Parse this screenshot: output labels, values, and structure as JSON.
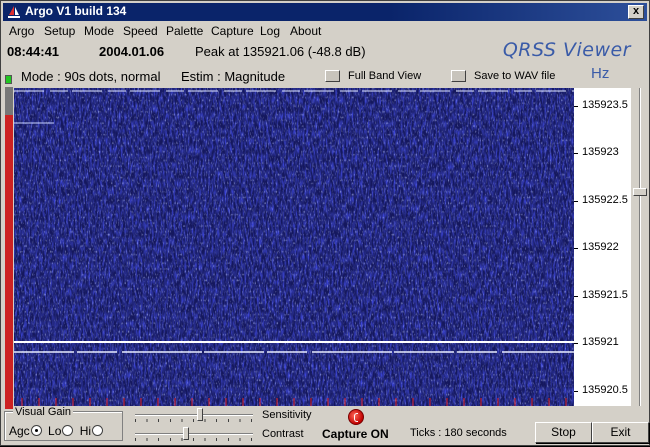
{
  "window": {
    "title": "Argo V1 build 134",
    "close_label": "x"
  },
  "menu": [
    "Argo",
    "Setup",
    "Mode",
    "Speed",
    "Palette",
    "Capture",
    "Log",
    "About"
  ],
  "info": {
    "time": "08:44:41",
    "date": "2004.01.06",
    "peak": "Peak at 135921.06 (-48.8 dB)",
    "brand": "QRSS Viewer",
    "mode": "Mode : 90s dots, normal",
    "estim": "Estim : Magnitude",
    "full_band_label": "Full Band View",
    "save_wav_label": "Save to WAV file",
    "unit": "Hz"
  },
  "axis": {
    "labels": [
      "135923.5",
      "135923",
      "135922.5",
      "135922",
      "135921.5",
      "135921",
      "135920.5"
    ]
  },
  "bottom": {
    "visual_gain_label": "Visual Gain",
    "agc_label": "Agc",
    "lo_label": "Lo",
    "hi_label": "Hi",
    "selected_gain": "Agc",
    "sensitivity_label": "Sensitivity",
    "contrast_label": "Contrast",
    "sensitivity_level": 0.55,
    "contrast_level": 0.43,
    "capture_status": "Capture ON",
    "ticks": "Ticks  : 180 seconds",
    "stop_label": "Stop",
    "exit_label": "Exit"
  },
  "colors": {
    "waterfall_bg": "#15185e",
    "titlebar": "#0a246a",
    "brand": "#3a5ba8",
    "capture_led": "#c00000",
    "signal": "#ffffff"
  }
}
